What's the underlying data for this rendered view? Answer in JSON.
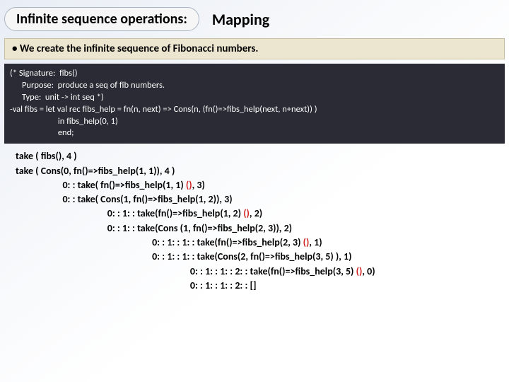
{
  "header": {
    "title_left": "Infinite sequence operations:",
    "title_right": "Mapping"
  },
  "bullet": "• We create the infinite sequence of Fibonacci numbers.",
  "code": {
    "l1": "(* Signature:  fibs()",
    "l2": "      Purpose:  produce a seq of fib numbers.",
    "l3": "      Type:  unit -> int seq *)",
    "l4": "-val fibs = let val rec fibs_help = fn(n, next) => Cons(n, (fn()=>fibs_help(next, n+next)) )",
    "l5": "                        in fibs_help(0, 1)",
    "l6": "                        end;"
  },
  "trace": {
    "l1a": "take ( fibs(), 4 )",
    "l2a": "take ( Cons(0, fn()=>fibs_help(1, 1)), 4 )",
    "l3a": "                     0: : take( fn()=>fibs_help(1, 1) ",
    "l3b": "()",
    "l3c": ", 3)",
    "l4a": "                     0: : take( Cons(1, fn()=>fibs_help(1, 2)), 3)",
    "l5a": "                                         0: : 1: : take(fn()=>fibs_help(1, 2) ",
    "l5b": "()",
    "l5c": ", 2)",
    "l6a": "                                         0: : 1: : take(Cons (1, fn()=>fibs_help(2, 3)), 2)",
    "l7a": "                                                             0: : 1: : 1: : take(fn()=>fibs_help(2, 3) ",
    "l7b": "()",
    "l7c": ", 1)",
    "l8a": "                                                             0: : 1: : 1: : take(Cons(2, fn()=>fibs_help(3, 5) ), 1)",
    "l9a": "                                                                              0: : 1: : 1: : 2: : take(fn()=>fibs_help(3, 5) ",
    "l9b": "()",
    "l9c": ", 0)",
    "l10a": "                                                                              0: : 1: : 1: : 2: : []"
  }
}
